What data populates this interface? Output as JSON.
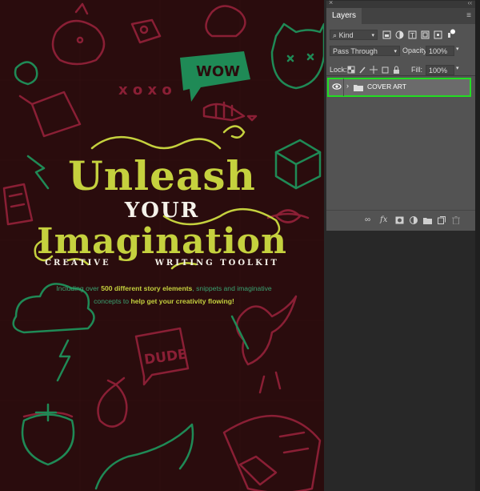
{
  "cover": {
    "title_line1": "Unleash",
    "title_line2": "YOUR",
    "title_line3": "Imagination",
    "subtitle_left": "CREATIVE",
    "subtitle_right": "WRITING TOOLKIT",
    "blurb_part1": "Including over ",
    "blurb_bold1": "500 different story elements",
    "blurb_part2": ", snippets and imaginative concepts to ",
    "blurb_bold2": "help get your creativity flowing!",
    "bubble_wow": "WOW",
    "bubble_dude": "DUDE",
    "xo": "XOXO"
  },
  "panel": {
    "tab_label": "Layers",
    "filter_label": "Kind",
    "blend_mode": "Pass Through",
    "opacity_label": "Opacity:",
    "opacity_value": "100%",
    "lock_label": "Lock:",
    "fill_label": "Fill:",
    "fill_value": "100%",
    "layer_name": "COVER ART"
  },
  "colors": {
    "canvas_bg": "#2a0c0d",
    "title_yellow": "#c5d13e",
    "doodle_red": "#8a1f35",
    "doodle_green": "#1f8a56",
    "highlight": "#22dd22"
  }
}
